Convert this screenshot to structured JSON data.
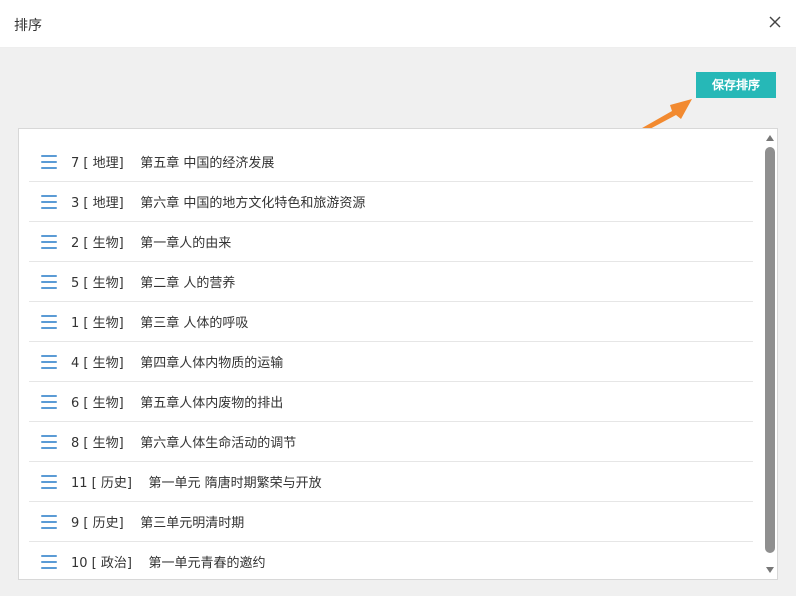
{
  "dialog": {
    "title": "排序",
    "save_label": "保存排序"
  },
  "icons": {
    "close": "close-icon",
    "drag": "drag-handle-icon",
    "arrow": "pointer-arrow-icon"
  },
  "colors": {
    "accent": "#26b8b7",
    "arrow": "#f28a30",
    "handle": "#5b9bd5"
  },
  "sort_list": {
    "items": [
      {
        "label": "7 [ 地理]    第五章 中国的经济发展"
      },
      {
        "label": "3 [ 地理]    第六章 中国的地方文化特色和旅游资源"
      },
      {
        "label": "2 [ 生物]    第一章人的由来"
      },
      {
        "label": "5 [ 生物]    第二章 人的营养"
      },
      {
        "label": "1 [ 生物]    第三章 人体的呼吸"
      },
      {
        "label": "4 [ 生物]    第四章人体内物质的运输"
      },
      {
        "label": "6 [ 生物]    第五章人体内废物的排出"
      },
      {
        "label": "8 [ 生物]    第六章人体生命活动的调节"
      },
      {
        "label": "11 [ 历史]    第一单元 隋唐时期繁荣与开放"
      },
      {
        "label": "9 [ 历史]    第三单元明清时期"
      },
      {
        "label": "10 [ 政治]    第一单元青春的邀约"
      }
    ]
  }
}
